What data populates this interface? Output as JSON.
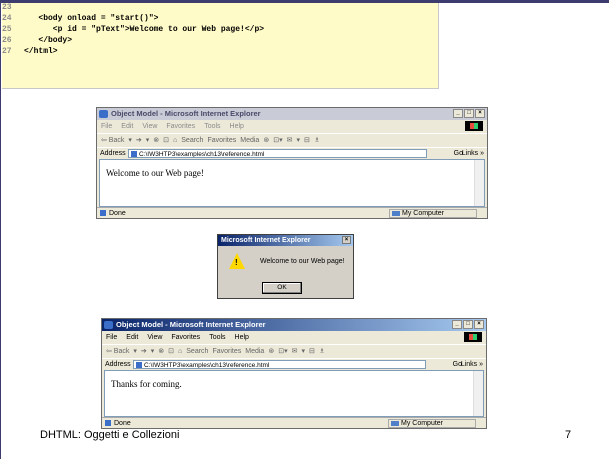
{
  "code": {
    "lines": [
      {
        "num": "23",
        "text": ""
      },
      {
        "num": "24",
        "text": "   <body onload = \"start()\">"
      },
      {
        "num": "25",
        "text": "      <p id = \"pText\">Welcome to our Web page!</p>"
      },
      {
        "num": "26",
        "text": "   </body>"
      },
      {
        "num": "27",
        "text": "</html>"
      }
    ]
  },
  "browser1": {
    "title": "Object Model - Microsoft Internet Explorer",
    "menu": [
      "File",
      "Edit",
      "View",
      "Favorites",
      "Tools",
      "Help"
    ],
    "toolbar": [
      "⇦ Back",
      "▾",
      "➔",
      "▾",
      "⊗",
      "⊡",
      "⌂",
      "Search",
      "Favorites",
      "Media",
      "⊛",
      "⊡▾",
      "✉",
      "▾",
      "⊟",
      "♗"
    ],
    "address_label": "Address",
    "address_value": "C:\\IW3HTP3\\examples\\ch13\\reference.html",
    "go_label": "Go",
    "links_label": "Links »",
    "content_text": "Welcome to our Web page!",
    "status_text": "Done",
    "zone_text": "My Computer"
  },
  "dialog": {
    "title": "Microsoft Internet Explorer",
    "message": "Welcome to our Web page!",
    "ok_label": "OK",
    "icon_mark": "!"
  },
  "browser2": {
    "title": "Object Model - Microsoft Internet Explorer",
    "menu": [
      "File",
      "Edit",
      "View",
      "Favorites",
      "Tools",
      "Help"
    ],
    "toolbar": [
      "⇦ Back",
      "▾",
      "➔",
      "▾",
      "⊗",
      "⊡",
      "⌂",
      "Search",
      "Favorites",
      "Media",
      "⊛",
      "⊡▾",
      "✉",
      "▾",
      "⊟",
      "♗"
    ],
    "address_label": "Address",
    "address_value": "C:\\IW3HTP3\\examples\\ch13\\reference.html",
    "go_label": "Go",
    "links_label": "Links »",
    "content_text": "Thanks for coming.",
    "status_text": "Done",
    "zone_text": "My Computer"
  },
  "footer": {
    "text": "DHTML: Oggetti e Collezioni",
    "page_number": "7"
  }
}
